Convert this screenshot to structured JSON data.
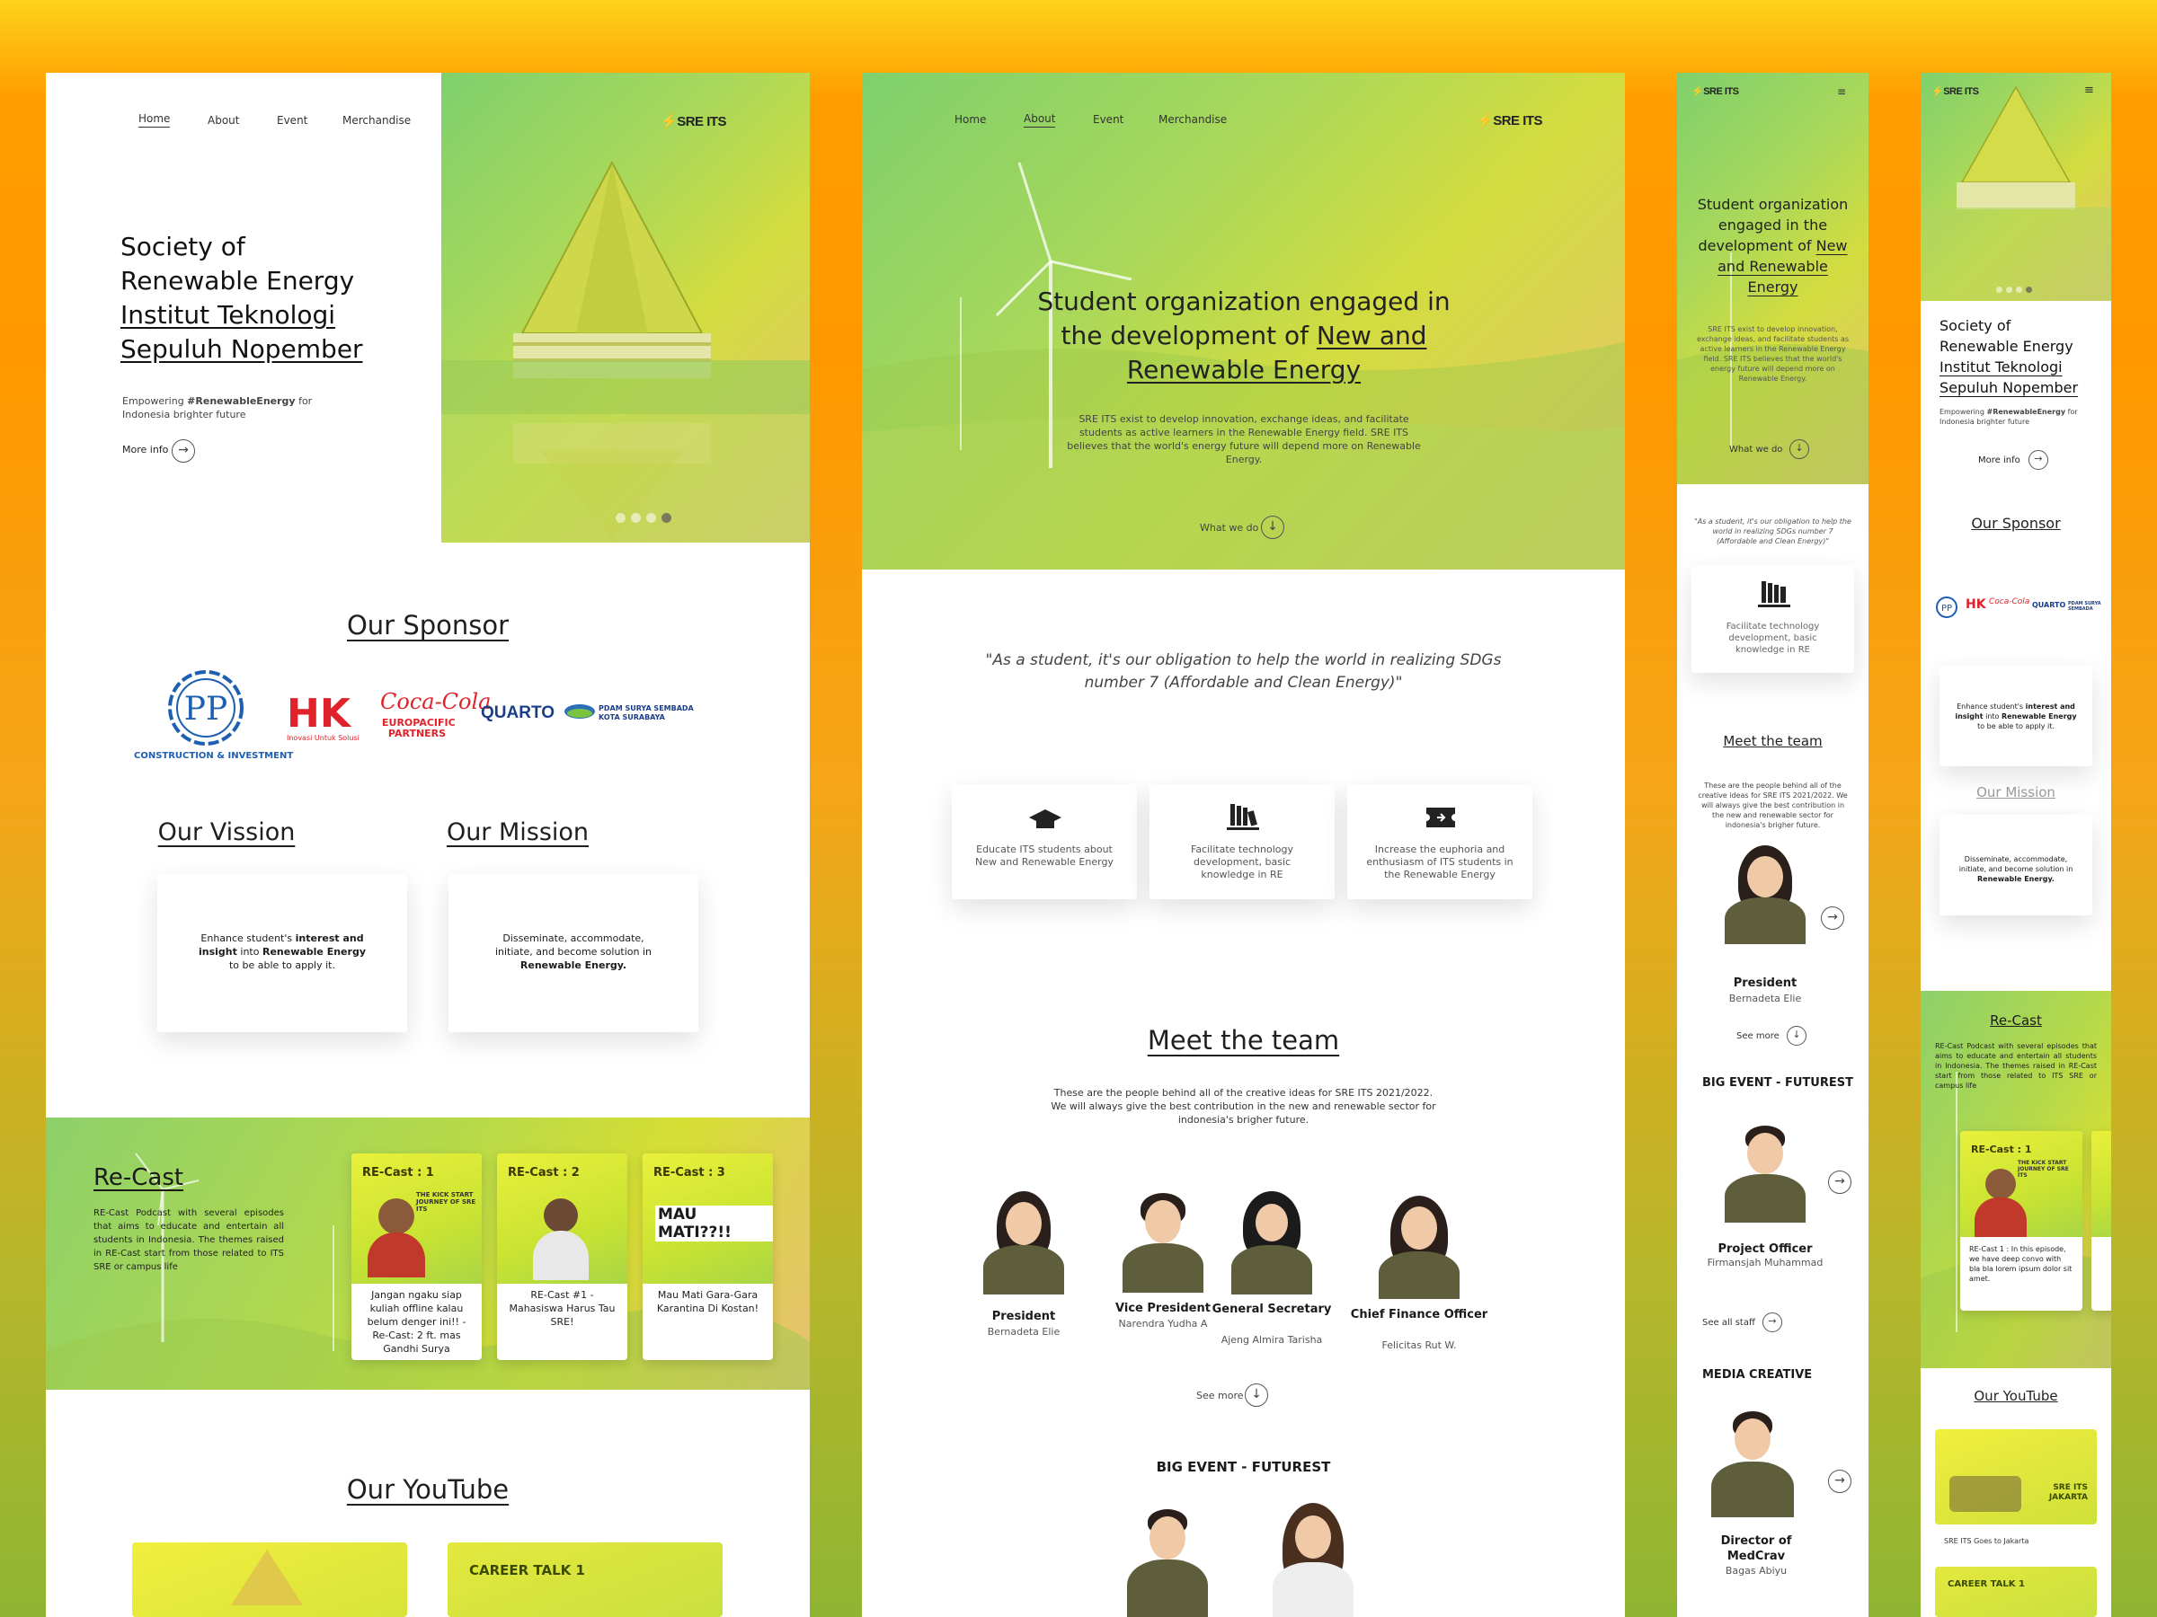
{
  "nav": [
    "Home",
    "About",
    "Event",
    "Merchandise"
  ],
  "brand": "SRE ITS",
  "hero": {
    "title_line1": "Society of",
    "title_line2": "Renewable Energy",
    "title_line3": "Institut Teknologi",
    "title_line4": "Sepuluh Nopember",
    "sub_pre": "Empowering ",
    "sub_tag": "#RenewableEnergy",
    "sub_post": " for Indonesia brighter future",
    "more": "More info"
  },
  "sponsor": {
    "title": "Our Sponsor",
    "logos": [
      {
        "name": "PP",
        "caption": "CONSTRUCTION & INVESTMENT"
      },
      {
        "name": "HK",
        "caption": "Inovasi Untuk Solusi"
      },
      {
        "name": "Coca-Cola",
        "caption": "EUROPACIFIC PARTNERS"
      },
      {
        "name": "QUARTO",
        "caption": ""
      },
      {
        "name": "PDAM SURYA SEMBADA",
        "caption": "KOTA SURABAYA"
      }
    ]
  },
  "vision": {
    "title": "Our Vission",
    "t1": "Enhance student's ",
    "b1": "interest and insight",
    "t2": " into ",
    "b2": "Renewable Energy",
    "t3": " to be able to apply it."
  },
  "mission": {
    "title": "Our Mission",
    "t1": "Disseminate, accommodate, initiate, and become solution in ",
    "b1": "Renewable Energy."
  },
  "recast": {
    "title": "Re-Cast",
    "desc": "RE-Cast Podcast with several episodes that aims to educate and entertain all students in Indonesia. The themes raised in RE-Cast start from those related to ITS SRE or campus life",
    "cards": [
      {
        "label": "RE-Cast : 1",
        "text": "Jangan ngaku siap kuliah offline kalau belum denger ini!! - Re-Cast: 2 ft. mas Gandhi Surya"
      },
      {
        "label": "RE-Cast : 2",
        "text": "RE-Cast #1 - Mahasiswa Harus Tau SRE!"
      },
      {
        "label": "RE-Cast : 3",
        "text": "Mau Mati Gara-Gara Karantina Di Kostan!"
      }
    ],
    "card1_headline": "THE KICK START JOURNEY OF SRE ITS",
    "card3_headline": "MAU MATI??!!"
  },
  "youtube": {
    "title": "Our YouTube",
    "card2": "CAREER TALK 1",
    "mobile_caption": "SRE ITS Goes to Jakarta",
    "jakarta": "SRE ITS JAKARTA"
  },
  "about": {
    "headline_1": "Student organization engaged in",
    "headline_2": "the development of ",
    "headline_u": "New and Renewable Energy",
    "desc": "SRE ITS exist to develop innovation, exchange ideas, and facilitate students as active learners in the Renewable Energy field. SRE ITS believes that the world's energy future will depend more on Renewable Energy.",
    "what": "What we do",
    "quote": "\"As a student, it's our obligation to help the world in realizing SDGs number 7 (Affordable and Clean Energy)\"",
    "features": [
      "Educate ITS students about New and Renewable Energy",
      "Facilitate technology development, basic knowledge in RE",
      "Increase the euphoria and enthusiasm of ITS students in the Renewable Energy"
    ]
  },
  "team": {
    "title": "Meet the team",
    "desc": "These are the people behind all of the creative ideas for SRE ITS 2021/2022. We will always give the best contribution in the new and renewable sector for indonesia's brigher future.",
    "members": [
      {
        "role": "President",
        "name": "Bernadeta Elie"
      },
      {
        "role": "Vice President",
        "name": "Narendra Yudha A"
      },
      {
        "role": "General Secretary",
        "name": "Ajeng Almira Tarisha"
      },
      {
        "role": "Chief Finance Officer",
        "name": "Felicitas Rut W."
      }
    ],
    "see_more": "See more",
    "big_event": "BIG EVENT - FUTUREST",
    "mobile_big_event": "BIG EVENT - FUTUREST",
    "project_role": "Project Officer",
    "project_name": "Firmansjah Muhammad",
    "see_all": "See all staff",
    "media": "MEDIA CREATIVE",
    "director_role": "Director of MedCrav",
    "director_name": "Bagas Abiyu"
  },
  "mobile_recast_text": "RE-Cast 1 : In this episode, we have deep convo with bla bla lorem ipsum dolor sit amet.",
  "colors": {
    "accent": "#f5b800",
    "hero_green": "#8fd06a",
    "bg_orange": "#ff9800"
  }
}
